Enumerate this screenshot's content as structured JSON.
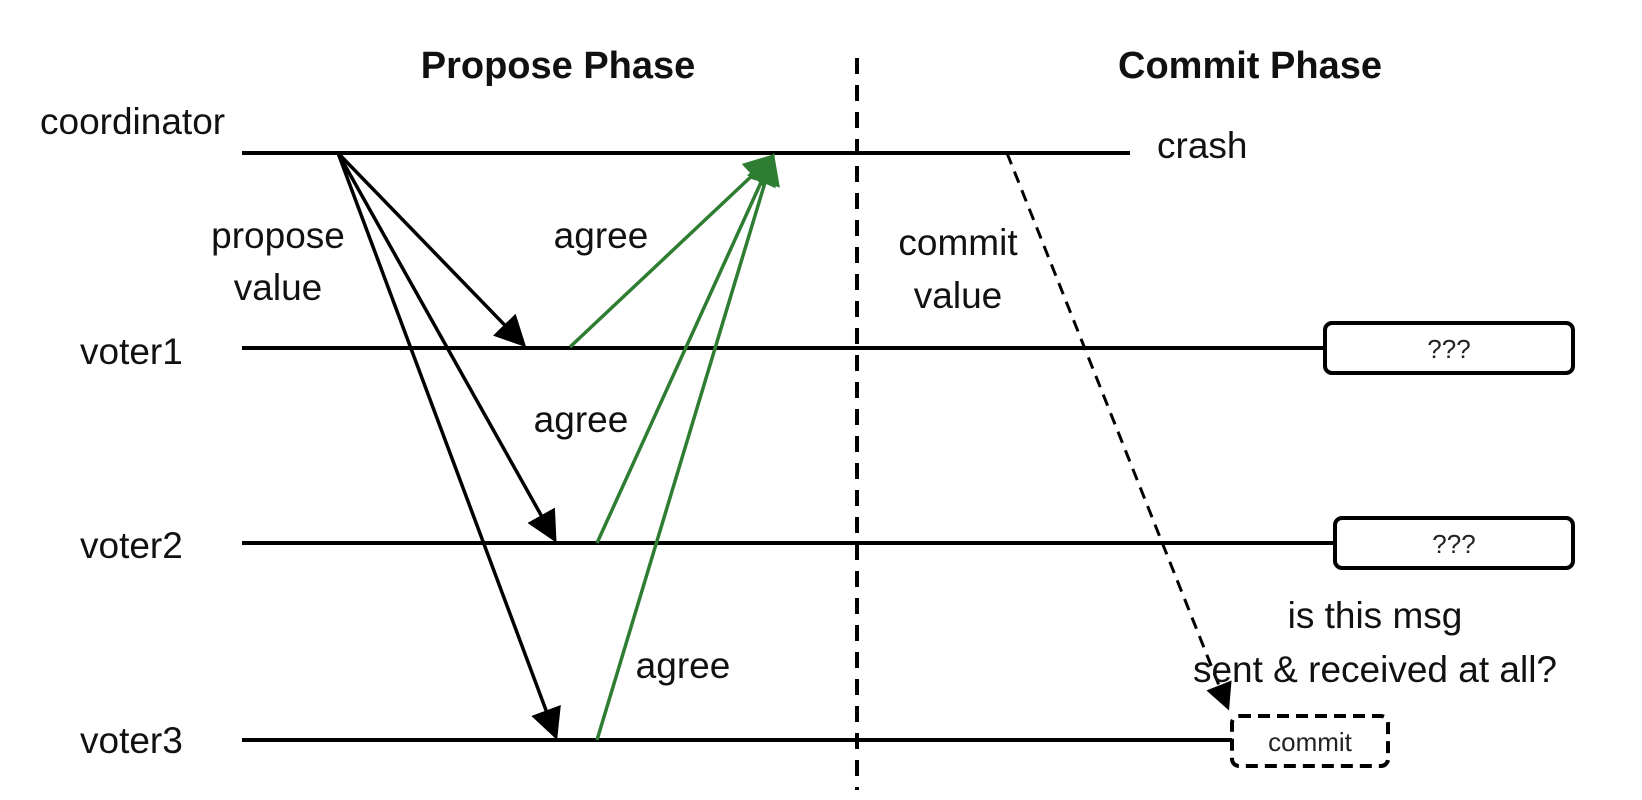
{
  "phases": {
    "propose": "Propose Phase",
    "commit": "Commit Phase"
  },
  "participants": {
    "coordinator": "coordinator",
    "voter1": "voter1",
    "voter2": "voter2",
    "voter3": "voter3"
  },
  "events": {
    "crash": "crash"
  },
  "messages": {
    "propose_line1": "propose",
    "propose_line2": "value",
    "agree": "agree",
    "commit_line1": "commit",
    "commit_line2": "value"
  },
  "outcomes": {
    "voter1_state": "???",
    "voter2_state": "???",
    "voter3_state": "commit"
  },
  "question": {
    "line1": "is this msg",
    "line2": "sent & received  at all?"
  },
  "colors": {
    "line": "#000000",
    "agree_arrow": "#2e7d32",
    "text": "#111111"
  }
}
